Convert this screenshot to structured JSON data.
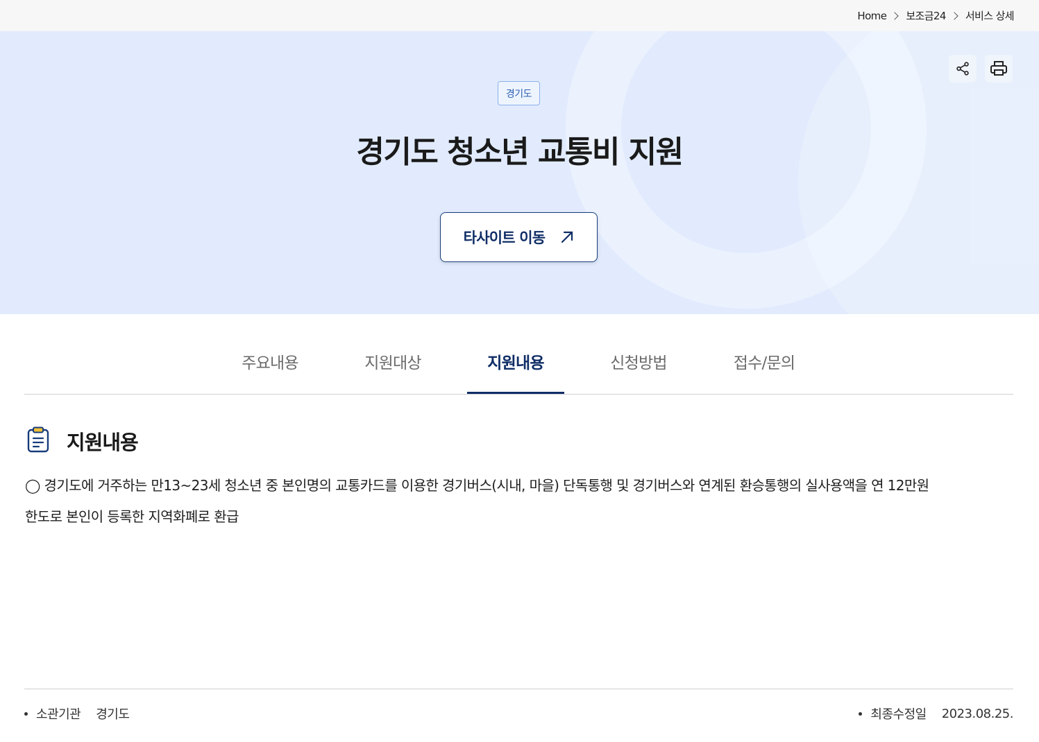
{
  "breadcrumb": [
    "Home",
    "보조금24",
    "서비스 상세"
  ],
  "hero": {
    "region_badge": "경기도",
    "title": "경기도 청소년 교통비 지원",
    "site_button_label": "타사이트 이동"
  },
  "actions": {
    "share_icon": "share-icon",
    "print_icon": "print-icon"
  },
  "tabs": [
    {
      "label": "주요내용",
      "active": false
    },
    {
      "label": "지원대상",
      "active": false
    },
    {
      "label": "지원내용",
      "active": true
    },
    {
      "label": "신청방법",
      "active": false
    },
    {
      "label": "접수/문의",
      "active": false
    }
  ],
  "section": {
    "icon": "clipboard-icon",
    "title": "지원내용",
    "body_line1": "◯ 경기도에 거주하는 만13~23세 청소년 중 본인명의 교통카드를 이용한 경기버스(시내, 마을) 단독통행 및 경기버스와 연계된 환승통행의 실사용액을 연 12만원",
    "body_line2": "한도로 본인이 등록한 지역화폐로 환급"
  },
  "footer": {
    "agency_label": "소관기관",
    "agency_value": "경기도",
    "updated_label": "최종수정일",
    "updated_value": "2023.08.25."
  },
  "colors": {
    "hero_bg": "#e1ebfd",
    "accent": "#0f2d66",
    "badge_text": "#2b5fb3"
  }
}
